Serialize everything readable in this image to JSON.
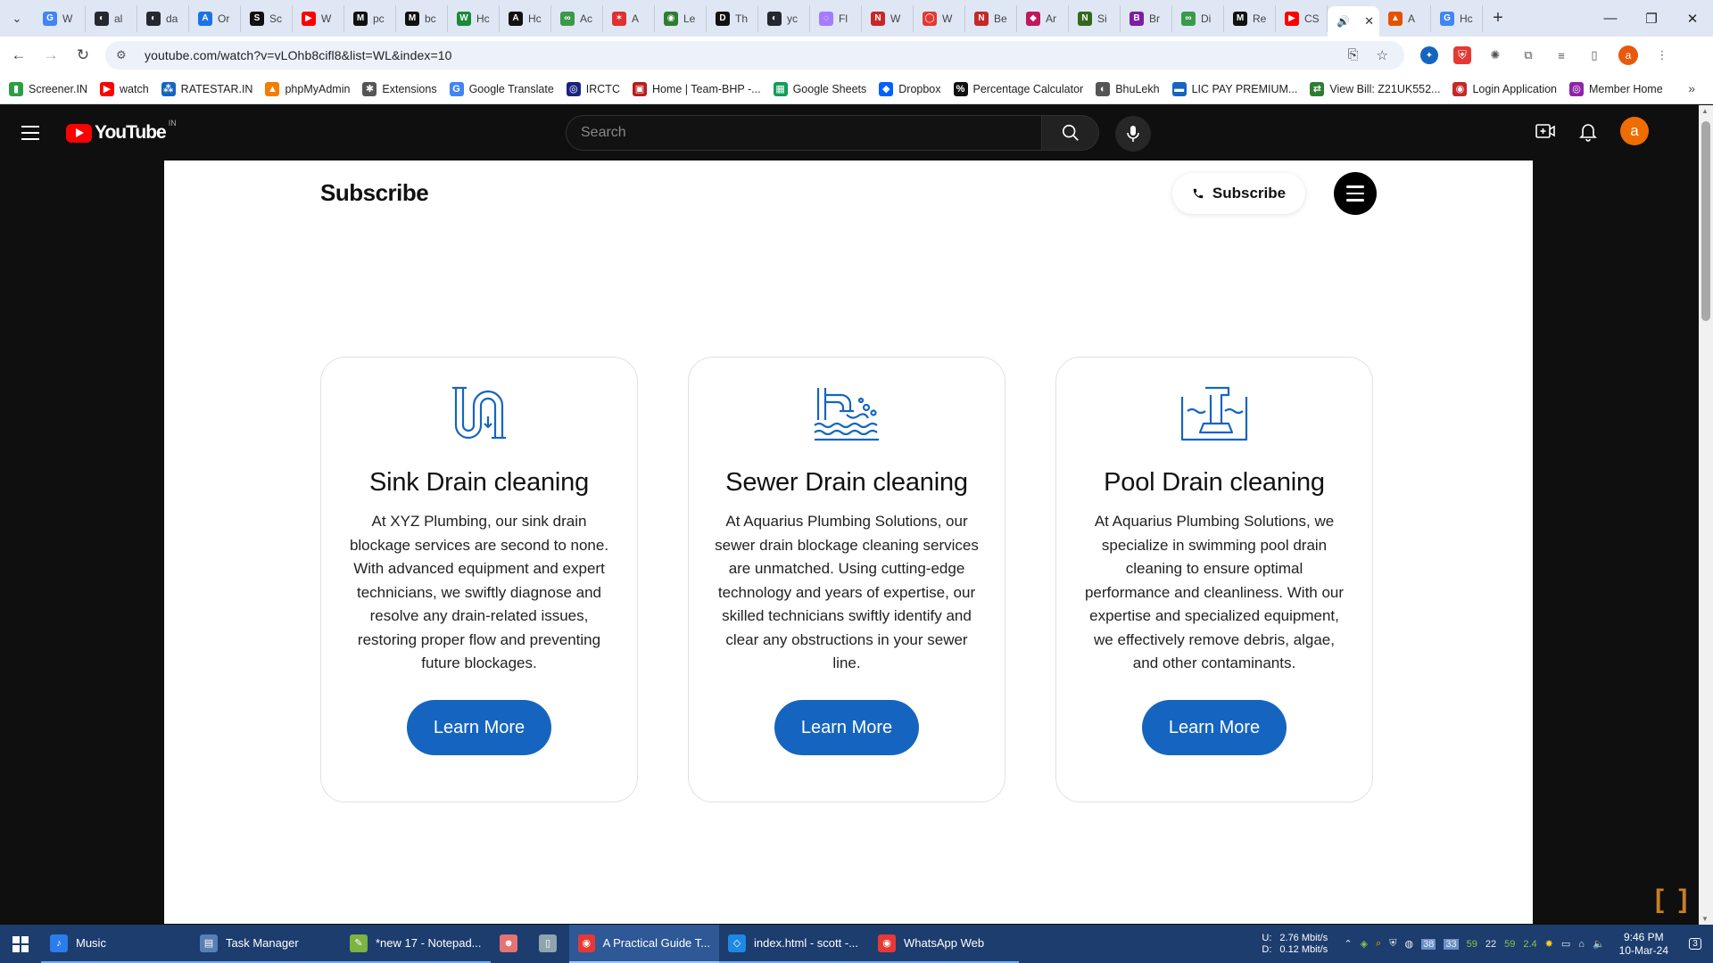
{
  "browser": {
    "tabs": [
      {
        "icon": "G",
        "label": "W",
        "color": "#4285f4"
      },
      {
        "icon": "◐",
        "label": "al",
        "color": "#24292f"
      },
      {
        "icon": "◐",
        "label": "da",
        "color": "#24292f"
      },
      {
        "icon": "A",
        "label": "Or",
        "color": "#1a73e8"
      },
      {
        "icon": "S",
        "label": "Sc",
        "color": "#111111"
      },
      {
        "icon": "▶",
        "label": "W",
        "color": "#ff0000"
      },
      {
        "icon": "M",
        "label": "pc",
        "color": "#111111"
      },
      {
        "icon": "M",
        "label": "bc",
        "color": "#111111"
      },
      {
        "icon": "W",
        "label": "Hc",
        "color": "#1a8a3a"
      },
      {
        "icon": "A",
        "label": "Hc",
        "color": "#111111"
      },
      {
        "icon": "∞",
        "label": "Ac",
        "color": "#3a9a4a"
      },
      {
        "icon": "✶",
        "label": "A",
        "color": "#e03030"
      },
      {
        "icon": "◉",
        "label": "Le",
        "color": "#2e7d32"
      },
      {
        "icon": "D",
        "label": "Th",
        "color": "#111111"
      },
      {
        "icon": "◐",
        "label": "yc",
        "color": "#24292f"
      },
      {
        "icon": "◌",
        "label": "Fl",
        "color": "#a67cff"
      },
      {
        "icon": "N",
        "label": "W",
        "color": "#c62828"
      },
      {
        "icon": "◯",
        "label": "W",
        "color": "#e53935"
      },
      {
        "icon": "N",
        "label": "Be",
        "color": "#c62828"
      },
      {
        "icon": "◆",
        "label": "Ar",
        "color": "#c2185b"
      },
      {
        "icon": "N",
        "label": "Si",
        "color": "#33691e"
      },
      {
        "icon": "B",
        "label": "Br",
        "color": "#7b1fa2"
      },
      {
        "icon": "∞",
        "label": "Di",
        "color": "#3a9a4a"
      },
      {
        "icon": "M",
        "label": "Re",
        "color": "#111111"
      },
      {
        "icon": "▶",
        "label": "CS",
        "color": "#ff0000"
      }
    ],
    "active_tab": {
      "icon": "🔊",
      "close": "✕"
    },
    "tabs_after": [
      {
        "icon": "▲",
        "label": "A",
        "color": "#e65100"
      },
      {
        "icon": "G",
        "label": "Hc",
        "color": "#4285f4"
      }
    ],
    "new_tab": "+",
    "window_controls": {
      "minimize": "—",
      "restore": "❐",
      "close": "✕"
    },
    "url": "youtube.com/watch?v=vLOhb8cifl8&list=WL&index=10",
    "profile_letter": "a"
  },
  "bookmarks": [
    {
      "label": "Screener.IN",
      "icon": "▮",
      "color": "#2e9e44"
    },
    {
      "label": "watch",
      "icon": "▶",
      "color": "#ff0000"
    },
    {
      "label": "RATESTAR.IN",
      "icon": "⁂",
      "color": "#1565c0"
    },
    {
      "label": "phpMyAdmin",
      "icon": "▲",
      "color": "#f57c00"
    },
    {
      "label": "Extensions",
      "icon": "✱",
      "color": "#555555"
    },
    {
      "label": "Google Translate",
      "icon": "G",
      "color": "#4285f4"
    },
    {
      "label": "IRCTC",
      "icon": "◎",
      "color": "#1a237e"
    },
    {
      "label": "Home | Team-BHP -...",
      "icon": "▣",
      "color": "#b71c1c"
    },
    {
      "label": "Google Sheets",
      "icon": "▦",
      "color": "#0f9d58"
    },
    {
      "label": "Dropbox",
      "icon": "◆",
      "color": "#0061ff"
    },
    {
      "label": "Percentage Calculator",
      "icon": "%",
      "color": "#111111"
    },
    {
      "label": "BhuLekh",
      "icon": "◐",
      "color": "#555555"
    },
    {
      "label": "LIC PAY PREMIUM...",
      "icon": "▬",
      "color": "#1565c0"
    },
    {
      "label": "View Bill: Z21UK552...",
      "icon": "⇄",
      "color": "#2e7d32"
    },
    {
      "label": "Login Application",
      "icon": "◉",
      "color": "#c62828"
    },
    {
      "label": "Member Home",
      "icon": "◎",
      "color": "#8e24aa"
    }
  ],
  "youtube": {
    "wordmark": "YouTube",
    "country": "IN",
    "search_placeholder": "Search",
    "avatar_letter": "a"
  },
  "site": {
    "logo": "Subscribe",
    "subscribe_button": "Subscribe",
    "cards": [
      {
        "title": "Sink Drain cleaning",
        "body": "At XYZ Plumbing, our sink drain blockage services are second to none. With advanced equipment and expert technicians, we swiftly diagnose and resolve any drain-related issues, restoring proper flow and preventing future blockages.",
        "button": "Learn More"
      },
      {
        "title": "Sewer Drain cleaning",
        "body": "At Aquarius Plumbing Solutions, our sewer drain blockage cleaning services are unmatched. Using cutting-edge technology and years of expertise, our skilled technicians swiftly identify and clear any obstructions in your sewer line.",
        "button": "Learn More"
      },
      {
        "title": "Pool Drain cleaning",
        "body": "At Aquarius Plumbing Solutions, we specialize in swimming pool drain cleaning to ensure optimal performance and cleanliness. With our expertise and specialized equipment, we effectively remove debris, algae, and other contaminants.",
        "button": "Learn More"
      }
    ],
    "accent_color": "#1565c0"
  },
  "taskbar": {
    "apps": [
      {
        "label": "Music",
        "icon": "♪",
        "color": "#2b7de9",
        "state": "open"
      },
      {
        "label": "Task Manager",
        "icon": "▤",
        "color": "#5a7fb5",
        "state": "open"
      },
      {
        "label": "*new 17 - Notepad...",
        "icon": "✎",
        "color": "#7cb342",
        "state": "open"
      },
      {
        "label": "",
        "icon": "☻",
        "color": "#e57373",
        "state": "plain"
      },
      {
        "label": "",
        "icon": "▯",
        "color": "#90a4ae",
        "state": "plain"
      },
      {
        "label": "A Practical Guide T...",
        "icon": "◉",
        "color": "#e53935",
        "state": "active"
      },
      {
        "label": "index.html - scott -...",
        "icon": "◇",
        "color": "#1e88e5",
        "state": "open"
      },
      {
        "label": "WhatsApp Web",
        "icon": "◉",
        "color": "#e53935",
        "state": "open"
      }
    ],
    "net_up_label": "U:",
    "net_up": "2.76 Mbit/s",
    "net_down_label": "D:",
    "net_down": "0.12 Mbit/s",
    "tray_values": [
      "59",
      "22",
      "59",
      "2.4"
    ],
    "time": "9:46 PM",
    "date": "10-Mar-24",
    "notifications": "3"
  }
}
